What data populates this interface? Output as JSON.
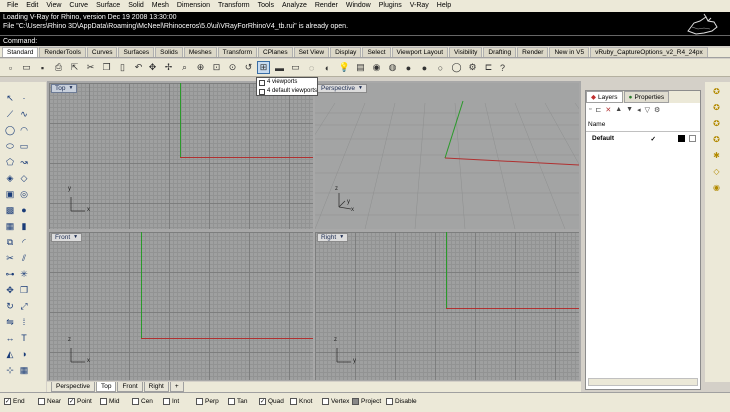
{
  "menu": [
    "File",
    "Edit",
    "View",
    "Curve",
    "Surface",
    "Solid",
    "Mesh",
    "Dimension",
    "Transform",
    "Tools",
    "Analyze",
    "Render",
    "Window",
    "Plugins",
    "V-Ray",
    "Help"
  ],
  "command_history": [
    "Loading V-Ray for Rhino, version Dec 19 2008  13:30:00",
    "File \"C:\\Users\\Rhino 3D\\AppData\\Roaming\\McNeel\\Rhinoceros\\5.0\\ui\\VRayForRhinoV4_tb.rui\" is already open."
  ],
  "command_prompt": "Command:",
  "toolbar_tabs": [
    "Standard",
    "RenderTools",
    "Curves",
    "Surfaces",
    "Solids",
    "Meshes",
    "Transform",
    "CPlanes",
    "Set View",
    "Display",
    "Select",
    "Viewport Layout",
    "Visibility",
    "Drafting",
    "Render",
    "New in V5",
    "vRuby_CaptureOptions_v2_R4_24px"
  ],
  "active_toolbar_tab": "Standard",
  "viewport_dropdown": {
    "items": [
      "4 viewports",
      "4 default viewports"
    ]
  },
  "viewports": {
    "top": "Top",
    "perspective": "Perspective",
    "front": "Front",
    "right": "Right"
  },
  "axis_letters": {
    "x": "x",
    "y": "y",
    "z": "z"
  },
  "viewport_tabs": [
    "Perspective",
    "Top",
    "Front",
    "Right",
    "+"
  ],
  "active_viewport_tab": "Top",
  "panel": {
    "tabs": [
      "Layers",
      "Properties"
    ],
    "active_tab": "Layers",
    "column_name": "Name",
    "layers": [
      {
        "name": "Default",
        "check": "✓",
        "color": "#000000"
      }
    ]
  },
  "osnaps": [
    {
      "label": "End",
      "checked": true
    },
    {
      "label": "Near",
      "checked": false
    },
    {
      "label": "Point",
      "checked": true
    },
    {
      "label": "Mid",
      "checked": false
    },
    {
      "label": "Cen",
      "checked": false
    },
    {
      "label": "Int",
      "checked": false
    },
    {
      "label": "Perp",
      "checked": false
    },
    {
      "label": "Tan",
      "checked": false
    },
    {
      "label": "Quad",
      "checked": true
    },
    {
      "label": "Knot",
      "checked": false
    },
    {
      "label": "Vertex",
      "checked": false
    },
    {
      "label": "Project",
      "checked": false
    },
    {
      "label": "Disable",
      "checked": false
    }
  ],
  "colors": {
    "x_axis": "#b03030",
    "y_axis": "#2a9a2a",
    "viewport_bg": "#9fa0a0",
    "active_label": "#c8d0dc"
  }
}
